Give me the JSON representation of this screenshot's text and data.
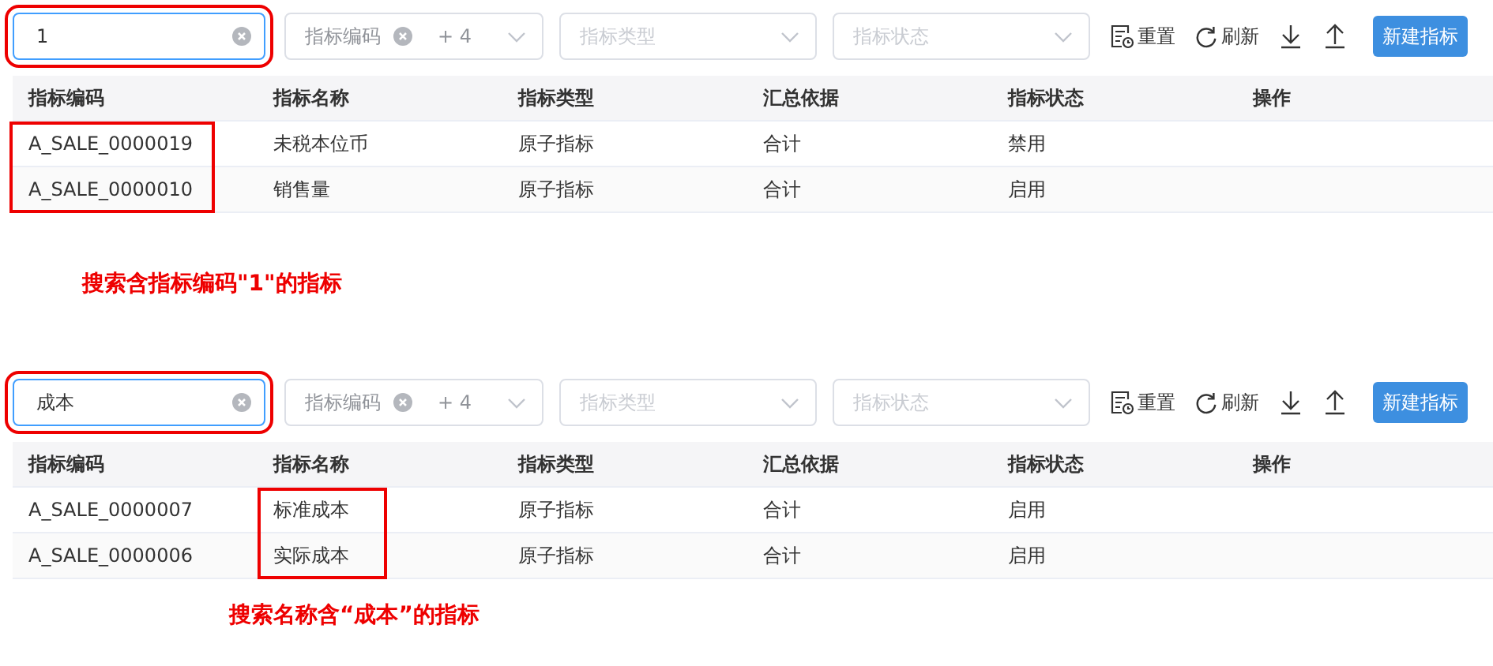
{
  "panels": [
    {
      "search": {
        "value": "1",
        "annotated": true
      },
      "filters": [
        {
          "kind": "multi",
          "tag": "指标编码",
          "more": "+ 4"
        },
        {
          "kind": "select",
          "placeholder": "指标类型"
        },
        {
          "kind": "select",
          "placeholder": "指标状态"
        }
      ],
      "actions": [
        {
          "kind": "reset",
          "label": "重置"
        },
        {
          "kind": "refresh",
          "label": "刷新"
        },
        {
          "kind": "download"
        },
        {
          "kind": "upload"
        },
        {
          "kind": "primary",
          "label": "新建指标"
        }
      ],
      "columns": [
        {
          "label": "指标编码",
          "annotated": true
        },
        {
          "label": "指标名称",
          "annotated": false
        },
        {
          "label": "指标类型",
          "annotated": false
        },
        {
          "label": "汇总依据",
          "annotated": false
        },
        {
          "label": "指标状态",
          "annotated": false
        },
        {
          "label": "操作",
          "annotated": false
        }
      ],
      "rows": [
        [
          "A_SALE_0000019",
          "未税本位币",
          "原子指标",
          "合计",
          "禁用"
        ],
        [
          "A_SALE_0000010",
          "销售量",
          "原子指标",
          "合计",
          "启用"
        ]
      ],
      "caption": "搜索含指标编码\"1\"的指标"
    },
    {
      "search": {
        "value": "成本",
        "annotated": true
      },
      "filters": [
        {
          "kind": "multi",
          "tag": "指标编码",
          "more": "+ 4"
        },
        {
          "kind": "select",
          "placeholder": "指标类型"
        },
        {
          "kind": "select",
          "placeholder": "指标状态"
        }
      ],
      "actions": [
        {
          "kind": "reset",
          "label": "重置"
        },
        {
          "kind": "refresh",
          "label": "刷新"
        },
        {
          "kind": "download"
        },
        {
          "kind": "upload"
        },
        {
          "kind": "primary",
          "label": "新建指标"
        }
      ],
      "columns": [
        {
          "label": "指标编码",
          "annotated": false
        },
        {
          "label": "指标名称",
          "annotated": true
        },
        {
          "label": "指标类型",
          "annotated": false
        },
        {
          "label": "汇总依据",
          "annotated": false
        },
        {
          "label": "指标状态",
          "annotated": false
        },
        {
          "label": "操作",
          "annotated": false
        }
      ],
      "rows": [
        [
          "A_SALE_0000007",
          "标准成本",
          "原子指标",
          "合计",
          "启用"
        ],
        [
          "A_SALE_0000006",
          "实际成本",
          "原子指标",
          "合计",
          "启用"
        ]
      ],
      "caption": "搜索名称含“成本”的指标"
    }
  ]
}
